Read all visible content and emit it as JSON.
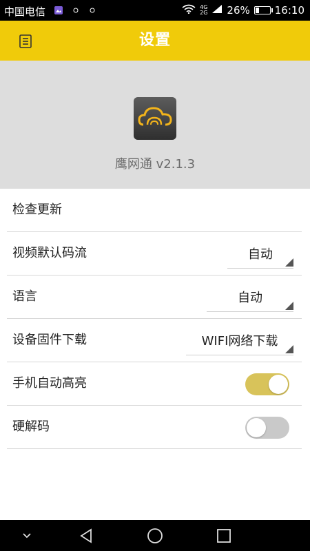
{
  "status_bar": {
    "carrier": "中国电信",
    "net_top": "4G",
    "net_bottom": "2G",
    "battery": "26%",
    "time": "16:10",
    "icons": [
      "gallery-icon",
      "sync-icon",
      "dot-icon",
      "wifi-icon",
      "signal-icon",
      "battery-icon"
    ]
  },
  "titlebar": {
    "title": "设置",
    "menu_icon": "menu-list-icon",
    "color": "#f0cb0a"
  },
  "app": {
    "logo_icon": "cloud-logo-icon",
    "version_text": "鹰网通 v2.1.3"
  },
  "settings": {
    "check_update": {
      "label": "检查更新"
    },
    "video_stream": {
      "label": "视频默认码流",
      "value": "自动"
    },
    "language": {
      "label": "语言",
      "value": "自动"
    },
    "firmware_download": {
      "label": "设备固件下载",
      "value": "WIFI网络下载"
    },
    "auto_brightness": {
      "label": "手机自动高亮",
      "on": true
    },
    "hardware_decode": {
      "label": "硬解码",
      "on": false
    }
  },
  "colors": {
    "toggle_on": "#d8c35a",
    "toggle_off": "#c9c9c9",
    "header_bg": "#dddddd"
  },
  "navbar": {
    "icons": [
      "chevron-down-icon",
      "back-icon",
      "home-icon",
      "recents-icon"
    ]
  }
}
